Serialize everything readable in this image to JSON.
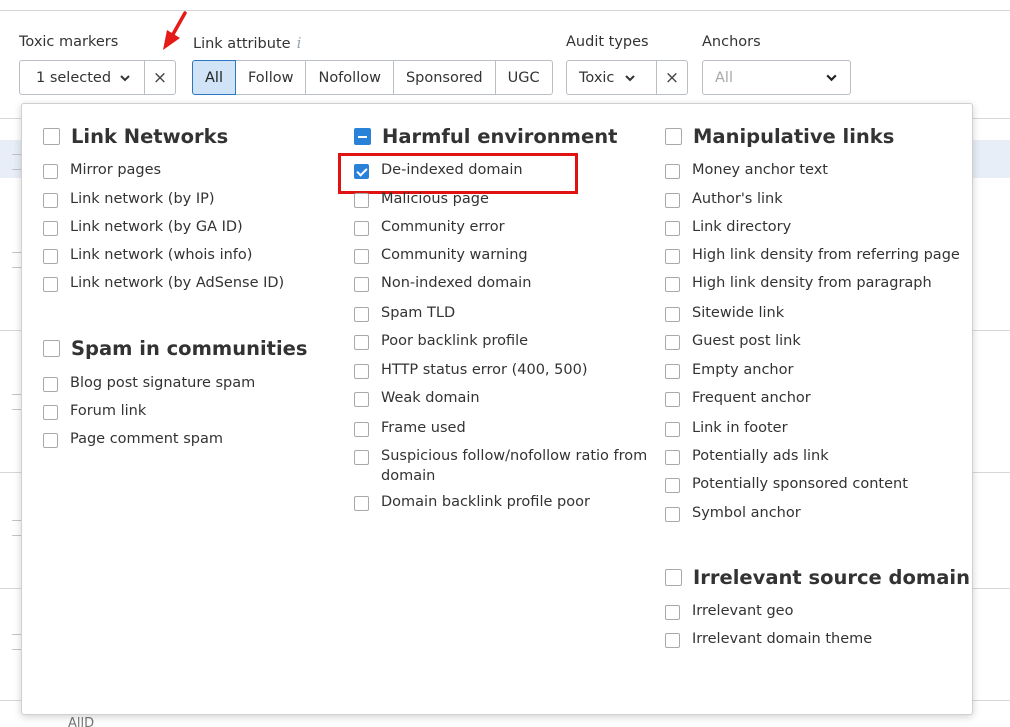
{
  "filters": {
    "toxic_markers": {
      "label": "Toxic markers",
      "value": "1 selected"
    },
    "link_attribute": {
      "label": "Link attribute",
      "options": [
        "All",
        "Follow",
        "Nofollow",
        "Sponsored",
        "UGC"
      ],
      "selected": "All"
    },
    "audit_types": {
      "label": "Audit types",
      "value": "Toxic"
    },
    "anchors": {
      "label": "Anchors",
      "placeholder": "All"
    }
  },
  "groups": {
    "link_networks": {
      "title": "Link Networks",
      "items": [
        "Mirror pages",
        "Link network (by IP)",
        "Link network (by GA ID)",
        "Link network (whois info)",
        "Link network (by AdSense ID)"
      ]
    },
    "spam_in_communities": {
      "title": "Spam in communities",
      "items": [
        "Blog post signature spam",
        "Forum link",
        "Page comment spam"
      ]
    },
    "harmful_environment": {
      "title": "Harmful environment",
      "state": "partial",
      "items": [
        "De-indexed domain",
        "Malicious page",
        "Community error",
        "Community warning",
        "Non-indexed domain",
        "Spam TLD",
        "Poor backlink profile",
        "HTTP status error (400, 500)",
        "Weak domain",
        "Frame used",
        "Suspicious follow/nofollow ratio from domain",
        "Domain backlink profile poor"
      ],
      "checked": [
        "De-indexed domain"
      ]
    },
    "manipulative_links": {
      "title": "Manipulative links",
      "items": [
        "Money anchor text",
        "Author's link",
        "Link directory",
        "High link density from referring page",
        "High link density from paragraph",
        "Sitewide link",
        "Guest post link",
        "Empty anchor",
        "Frequent anchor",
        "Link in footer",
        "Potentially ads link",
        "Potentially sponsored content",
        "Symbol anchor"
      ]
    },
    "irrelevant_source_domain": {
      "title": "Irrelevant source domain",
      "items": [
        "Irrelevant geo",
        "Irrelevant domain theme"
      ]
    }
  },
  "background": {
    "bottom_text": "AllD"
  },
  "colors": {
    "accent": "#2a82d8",
    "highlight_box": "#e01212",
    "active_segment": "#d1e3f6"
  },
  "icons": {
    "close": "×",
    "dropdown": "chevron-down",
    "info": "i",
    "annotation_arrow": "red-arrow"
  }
}
